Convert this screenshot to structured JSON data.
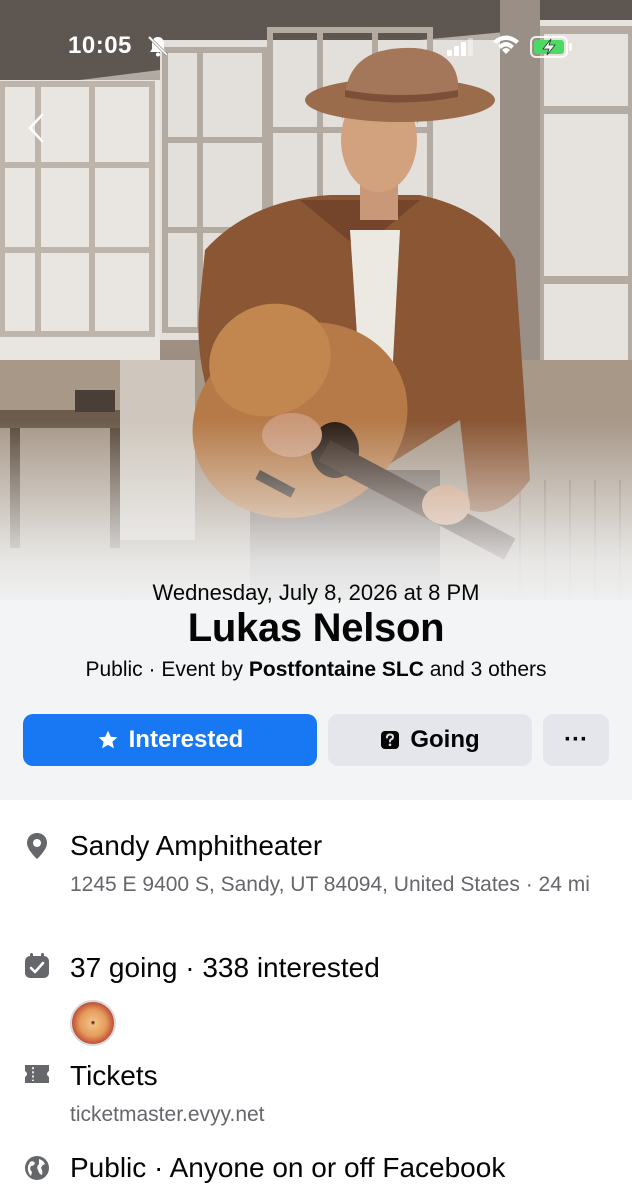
{
  "status_bar": {
    "time": "10:05",
    "icons": [
      "bell-slash-icon",
      "signal-icon",
      "wifi-icon",
      "battery-charging-icon"
    ]
  },
  "colors": {
    "primary_button": "#1877f2",
    "secondary_button": "#e4e6eb",
    "secondary_text": "#65676b"
  },
  "event": {
    "date": "Wednesday, July 8, 2026 at 8 PM",
    "title": "Lukas Nelson",
    "privacy": "Public · Event by ",
    "host": "Postfontaine SLC",
    "others": " and 3 others"
  },
  "actions": {
    "interested_label": "Interested",
    "going_label": "Going",
    "more_label": "···"
  },
  "details": {
    "location_name": "Sandy Amphitheater",
    "location_address": "1245 E 9400 S, Sandy, UT 84094, United States · 24 mi",
    "attendance": "37 going · 338 interested",
    "tickets_label": "Tickets",
    "tickets_url": "ticketmaster.evyy.net",
    "visibility": "Public · Anyone on or off Facebook"
  }
}
